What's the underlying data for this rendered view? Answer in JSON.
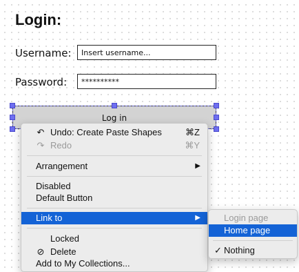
{
  "mockup": {
    "title": "Login:",
    "username_label": "Username:",
    "username_value": "Insert username...",
    "password_label": "Password:",
    "password_value": "**********",
    "login_button": "Log in"
  },
  "context_menu": {
    "undo": {
      "label": "Undo: Create Paste Shapes",
      "shortcut": "⌘Z",
      "icon": "undo-icon"
    },
    "redo": {
      "label": "Redo",
      "shortcut": "⌘Y",
      "icon": "redo-icon"
    },
    "arrangement": "Arrangement",
    "disabled": "Disabled",
    "default_button": "Default Button",
    "link_to": "Link to",
    "locked": "Locked",
    "delete": {
      "label": "Delete",
      "icon": "delete-icon"
    },
    "add_to_collections": "Add to My Collections..."
  },
  "submenu": {
    "login_page": "Login page",
    "home_page": "Home page",
    "nothing": "Nothing",
    "checked": "Nothing"
  },
  "colors": {
    "highlight": "#1463d6",
    "selection_handle": "#6e6ef0",
    "button_fill": "#d3d3d3"
  }
}
